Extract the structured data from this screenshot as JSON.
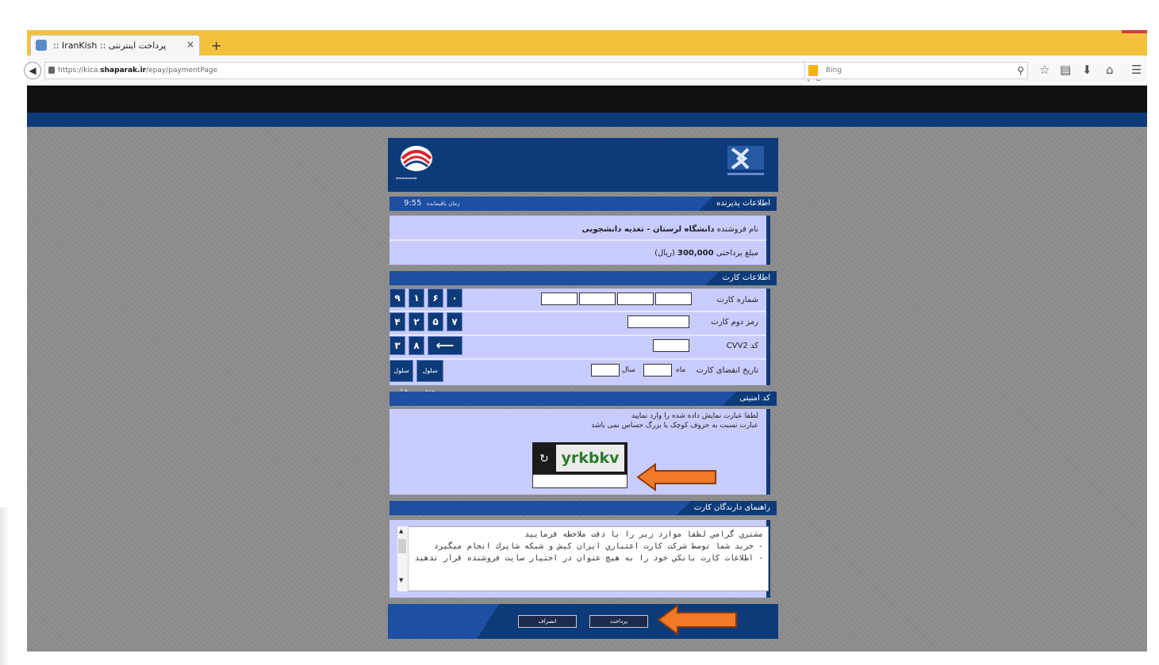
{
  "browser": {
    "tab_title": "پرداخت اینترنتی :: IranKish ::",
    "tab_close": "×",
    "new_tab": "+",
    "url_prefix": "https://kica.",
    "url_host": "shaparak.ir",
    "url_path": "/epay/paymentPage",
    "reload": "▽ C",
    "search_placeholder": "Bing",
    "search_icon": "search-icon",
    "icons": [
      "bookmark-star-icon",
      "reading-list-icon",
      "download-icon",
      "home-icon",
      "menu-icon"
    ]
  },
  "merchant": {
    "section_title": "اطلاعات پذیرنده",
    "timer_label": "زمان باقیمانده",
    "timer_value": "9:55",
    "name_label": "نام فروشنده",
    "name_value": "دانشگاه لرستان - تغذیه دانشجویی",
    "amount_label": "مبلغ پرداختی",
    "amount_value": "300,000",
    "amount_unit": "(ریال)"
  },
  "card": {
    "section_title": "اطلاعات کارت",
    "card_number_label": "شماره کارت",
    "pin2_label": "رمز دوم کارت",
    "cvv2_label": "کد CVV2",
    "expiry_label": "تاریخ انقضای کارت",
    "month_label": "ماه",
    "year_label": "سال",
    "keypad_row1": [
      "۹",
      "۱",
      "۶",
      "۰"
    ],
    "keypad_row2": [
      "۴",
      "۲",
      "۵",
      "۷"
    ],
    "keypad_row3": [
      "۳",
      "۸"
    ],
    "backspace": "⟵",
    "prev_cell": "سلول قبلی",
    "next_cell": "سلول بعدی"
  },
  "security": {
    "section_title": "کد امنیتی",
    "instruction_1": "لطفا عبارت نمایش داده شده را وارد نمایید",
    "instruction_2": "عبارت نسبت به حروف کوچک یا بزرگ حساس نمی باشد",
    "captcha_text": "yrkbkv",
    "refresh_icon": "↻"
  },
  "guide": {
    "section_title": "راهنمای دارندگان کارت",
    "text": "مشتري گرامي لطفا موارد زير را با دقت ملاحظه فرماييد\n- خريد شما توسط شركت كارت اعتباري ايران كيش و شبكه شاپرك انجام ميگيرد\n- اطلاعات كارت بانكي خود را به هيچ عنوان در اختيار سايت فروشنده قرار ندهيد"
  },
  "actions": {
    "pay": "پرداخت",
    "cancel": "انصراف"
  },
  "colors": {
    "header_blue": "#0d3b7a",
    "section_bg": "#c8ccff",
    "arrow_orange": "#f07a28"
  }
}
